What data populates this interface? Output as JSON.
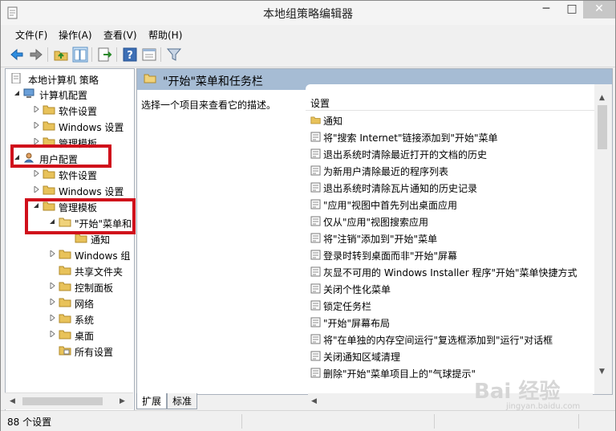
{
  "window": {
    "title": "本地组策略编辑器",
    "minimize": "─",
    "maximize": "□",
    "close": "✕"
  },
  "menu": [
    "文件(F)",
    "操作(A)",
    "查看(V)",
    "帮助(H)"
  ],
  "toolbar_icons": [
    "back-arrow-icon",
    "forward-arrow-icon",
    "up-folder-icon",
    "show-hide-tree-icon",
    "export-list-icon",
    "help-icon",
    "properties-icon",
    "filter-icon"
  ],
  "tree": {
    "root": "本地计算机 策略",
    "computer_config": "计算机配置",
    "computer_software": "软件设置",
    "computer_windows": "Windows 设置",
    "computer_admin": "管理模板",
    "user_config": "用户配置",
    "user_software": "软件设置",
    "user_windows": "Windows 设置",
    "user_admin": "管理模板",
    "start_menu": "\"开始\"菜单和",
    "notifications": "通知",
    "windows_components": "Windows 组",
    "shared_folders": "共享文件夹",
    "control_panel": "控制面板",
    "network": "网络",
    "system": "系统",
    "desktop": "桌面",
    "all_settings": "所有设置"
  },
  "right": {
    "header_title": "\"开始\"菜单和任务栏",
    "description": "选择一个项目来查看它的描述。",
    "column_header": "设置",
    "folder_item": "通知",
    "items": [
      "将\"搜索 Internet\"链接添加到\"开始\"菜单",
      "退出系统时清除最近打开的文档的历史",
      "为新用户清除最近的程序列表",
      "退出系统时清除瓦片通知的历史记录",
      "\"应用\"视图中首先列出桌面应用",
      "仅从\"应用\"视图搜索应用",
      "将\"注销\"添加到\"开始\"菜单",
      "登录时转到桌面而非\"开始\"屏幕",
      "灰显不可用的 Windows Installer 程序\"开始\"菜单快捷方式",
      "关闭个性化菜单",
      "锁定任务栏",
      "\"开始\"屏幕布局",
      "将\"在单独的内存空间运行\"复选框添加到\"运行\"对话框",
      "关闭通知区域清理",
      "删除\"开始\"菜单项目上的\"气球提示\""
    ]
  },
  "tabs": [
    "扩展",
    "标准"
  ],
  "status": "88 个设置",
  "watermark": {
    "logo": "Bai 经验",
    "url": "jingyan.baidu.com"
  },
  "colors": {
    "header_bg": "#a6bcd4",
    "highlight": "#d0101b",
    "folder": "#e8c25a"
  }
}
